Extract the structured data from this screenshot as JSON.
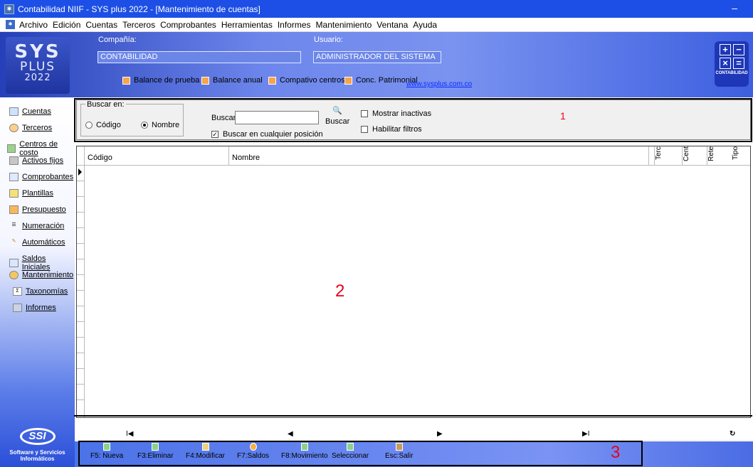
{
  "window": {
    "title": "Contabilidad NIIF - SYS plus 2022 - [Mantenimiento de cuentas]",
    "minimize": "–"
  },
  "menu": [
    "Archivo",
    "Edición",
    "Cuentas",
    "Terceros",
    "Comprobantes",
    "Herramientas",
    "Informes",
    "Mantenimiento",
    "Ventana",
    "Ayuda"
  ],
  "header": {
    "logo": {
      "line1": "SYS",
      "line2": "PLUS",
      "line3": "2022"
    },
    "company_label": "Compañía:",
    "company_value": "CONTABILIDAD",
    "user_label": "Usuario:",
    "user_value": "ADMINISTRADOR DEL SISTEMA",
    "report_buttons": [
      "Balance de prueba",
      "Balance anual",
      "Compativo centros",
      "Conc. Patrimonial"
    ],
    "weblink": "www.sysplus.com.co",
    "calc_logo": {
      "plus": "+",
      "minus": "−",
      "times": "×",
      "equals": "=",
      "label": "CONTABILIDAD"
    }
  },
  "sidebar": {
    "items": [
      "Cuentas",
      "Terceros",
      "Centros de costo",
      "Activos fijos",
      "Comprobantes",
      "Plantillas",
      "Presupuesto",
      "Numeración",
      "Automáticos",
      "Saldos Iniciales",
      "Mantenimiento",
      "Taxonomías",
      "Informes"
    ],
    "brand_logo": "SSI",
    "brand_text": "Software y Servicios Informáticos"
  },
  "search": {
    "group_label": "Buscar en:",
    "radio_codigo": "Código",
    "radio_nombre": "Nombre",
    "selected": "Nombre",
    "buscar_label": "Buscar:",
    "buscar_value": "",
    "buscar_button": "Buscar",
    "chk_anywhere": "Buscar en cualquier posición",
    "chk_anywhere_checked": true,
    "chk_inactive": "Mostrar inactivas",
    "chk_filters": "Habilitar filtros"
  },
  "grid": {
    "columns": [
      "Código",
      "Nombre",
      "Terc",
      "Cent",
      "Rete",
      "Tipo"
    ]
  },
  "navigator": {
    "first": "I◀",
    "prev": "◀",
    "next": "▶",
    "last": "▶I",
    "refresh": "↻"
  },
  "toolbar": [
    "F5: Nueva",
    "F3:Eliminar",
    "F4:Modificar",
    "F7:Saldos",
    "F8:Movimiento",
    "Seleccionar",
    "Esc:Salir"
  ],
  "annotations": {
    "one": "1",
    "two": "2",
    "three": "3"
  }
}
